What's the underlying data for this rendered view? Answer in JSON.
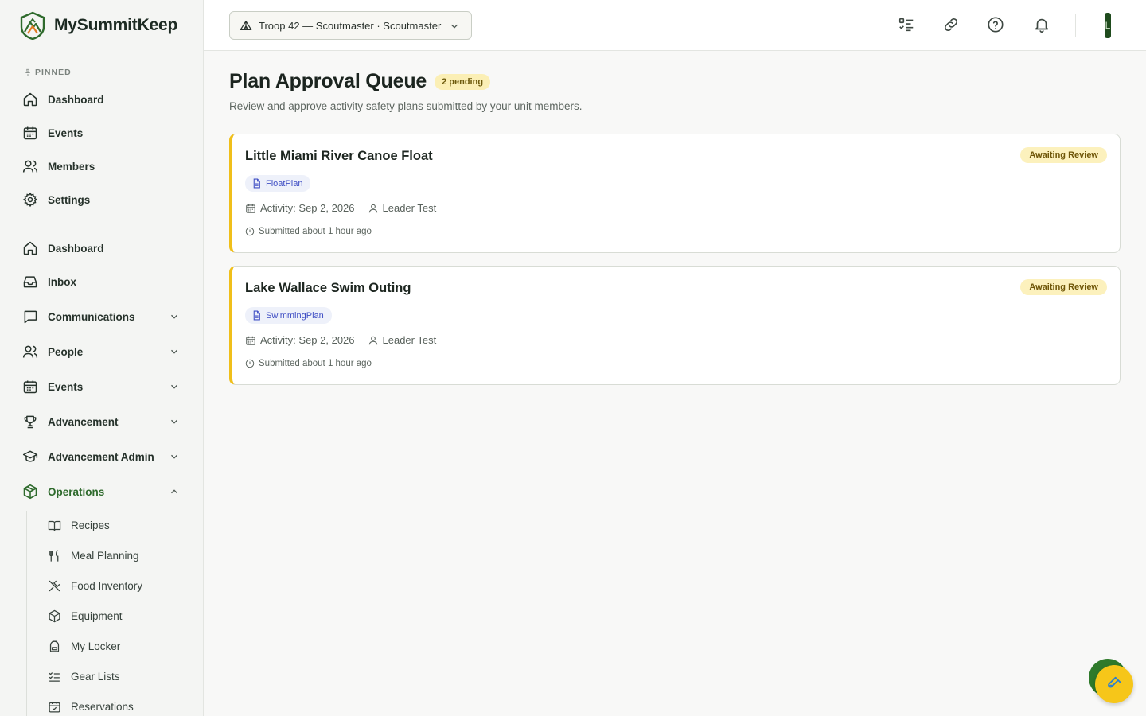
{
  "brand": {
    "name": "MySummitKeep"
  },
  "sidebar": {
    "pinned_label": "PINNED",
    "pinned": [
      {
        "label": "Dashboard"
      },
      {
        "label": "Events"
      },
      {
        "label": "Members"
      },
      {
        "label": "Settings"
      }
    ],
    "main": [
      {
        "label": "Dashboard"
      },
      {
        "label": "Inbox"
      },
      {
        "label": "Communications"
      },
      {
        "label": "People"
      },
      {
        "label": "Events"
      },
      {
        "label": "Advancement"
      },
      {
        "label": "Advancement Admin"
      },
      {
        "label": "Operations"
      }
    ],
    "operations_sub": [
      {
        "label": "Recipes"
      },
      {
        "label": "Meal Planning"
      },
      {
        "label": "Food Inventory"
      },
      {
        "label": "Equipment"
      },
      {
        "label": "My Locker"
      },
      {
        "label": "Gear Lists"
      },
      {
        "label": "Reservations"
      }
    ],
    "active_color": "#2e6a2c"
  },
  "header": {
    "unit_selector": "Troop 42 — Scoutmaster · Scoutmaster",
    "avatar_initial": "L"
  },
  "page": {
    "title": "Plan Approval Queue",
    "pending_badge": "2 pending",
    "subtitle": "Review and approve activity safety plans submitted by your unit members."
  },
  "plans": [
    {
      "title": "Little Miami River Canoe Float",
      "status": "Awaiting Review",
      "type": "FloatPlan",
      "activity": "Activity: Sep 2, 2026",
      "leader": "Leader Test",
      "submitted": "Submitted about 1 hour ago"
    },
    {
      "title": "Lake Wallace Swim Outing",
      "status": "Awaiting Review",
      "type": "SwimmingPlan",
      "activity": "Activity: Sep 2, 2026",
      "leader": "Leader Test",
      "submitted": "Submitted about 1 hour ago"
    }
  ],
  "colors": {
    "accent_yellow": "#f0bf1a",
    "brand_green": "#2e6a2c",
    "plan_type_blue": "#3f4ec4"
  }
}
